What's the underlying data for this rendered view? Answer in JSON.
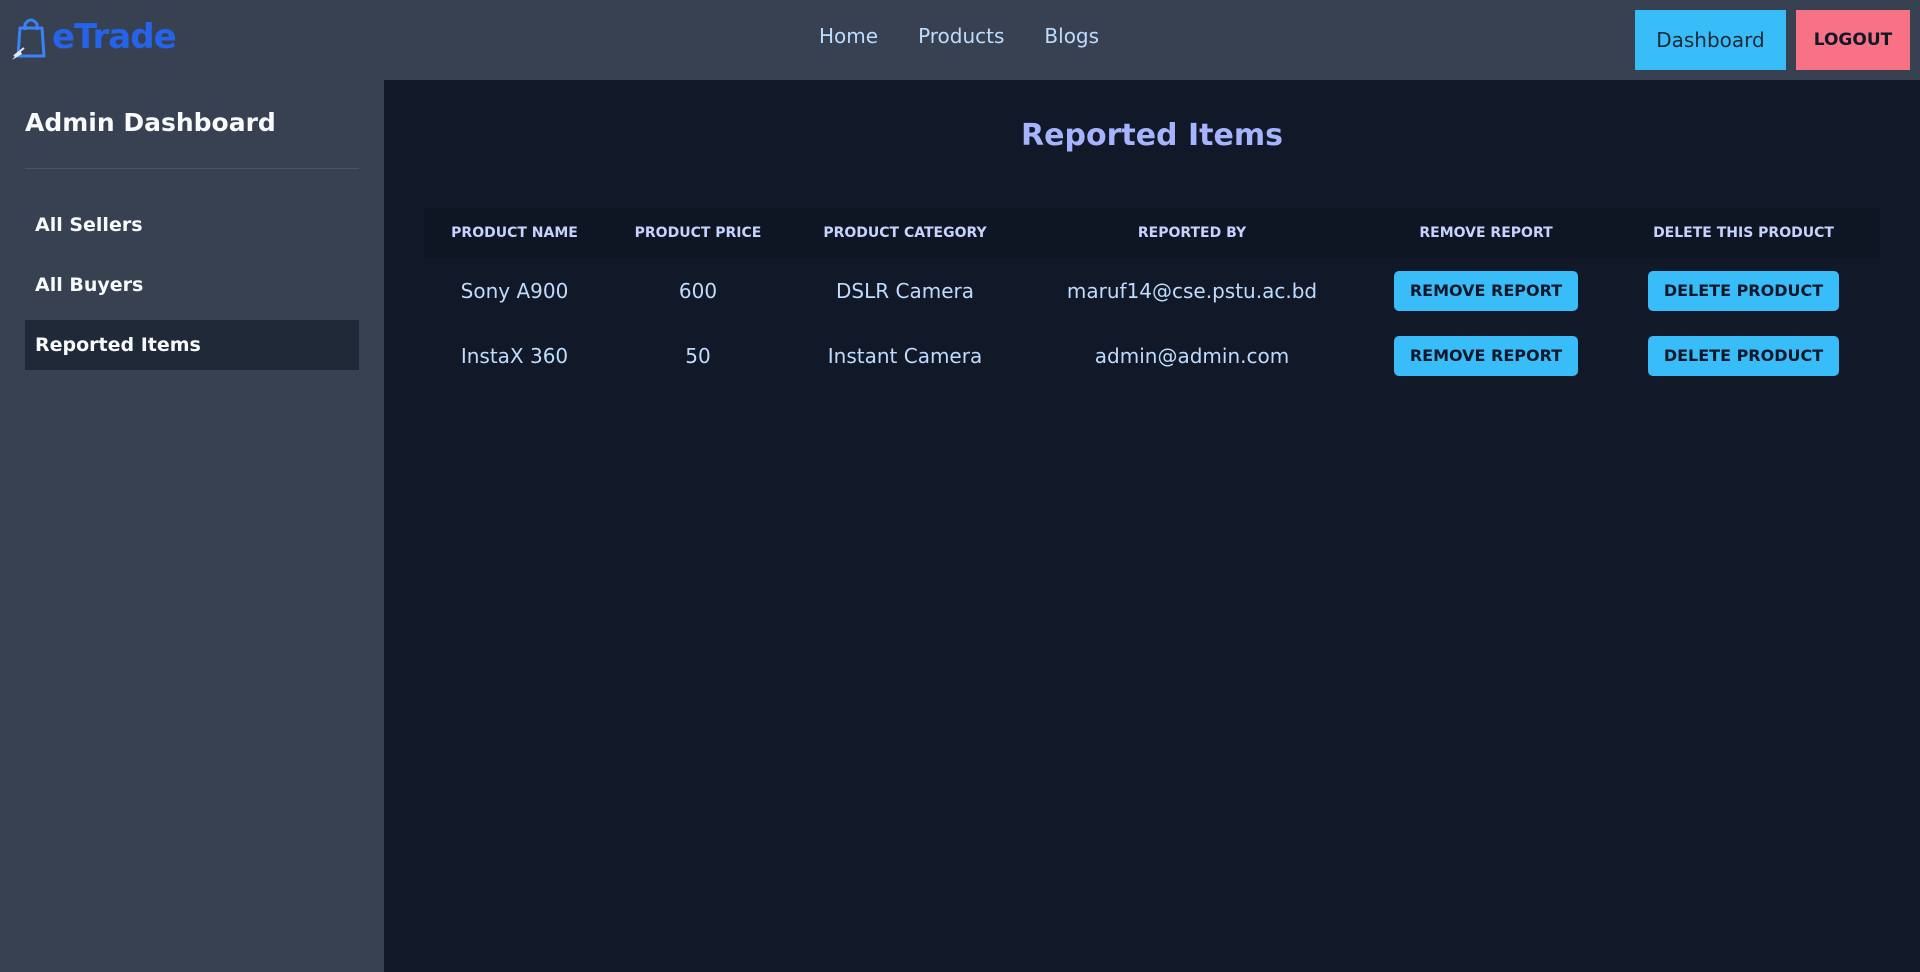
{
  "brand": {
    "name": "eTrade",
    "icon": "shopping-bag-icon"
  },
  "nav": {
    "links": [
      {
        "label": "Home"
      },
      {
        "label": "Products"
      },
      {
        "label": "Blogs"
      }
    ],
    "dashboard_label": "Dashboard",
    "logout_label": "LOGOUT"
  },
  "sidebar": {
    "title": "Admin Dashboard",
    "items": [
      {
        "label": "All Sellers",
        "active": false
      },
      {
        "label": "All Buyers",
        "active": false
      },
      {
        "label": "Reported Items",
        "active": true
      }
    ]
  },
  "main": {
    "title": "Reported Items",
    "table": {
      "headers": [
        "PRODUCT NAME",
        "PRODUCT PRICE",
        "PRODUCT CATEGORY",
        "REPORTED BY",
        "REMOVE REPORT",
        "DELETE THIS PRODUCT"
      ],
      "rows": [
        {
          "name": "Sony A900",
          "price": "600",
          "category": "DSLR Camera",
          "reported_by": "maruf14@cse.pstu.ac.bd",
          "remove_label": "REMOVE REPORT",
          "delete_label": "DELETE PRODUCT"
        },
        {
          "name": "InstaX 360",
          "price": "50",
          "category": "Instant Camera",
          "reported_by": "admin@admin.com",
          "remove_label": "REMOVE REPORT",
          "delete_label": "DELETE PRODUCT"
        }
      ]
    }
  },
  "colors": {
    "navbar_bg": "#374151",
    "main_bg": "#111827",
    "accent_button": "#38bdf8",
    "logout_button": "#f87185",
    "brand_blue": "#2563eb"
  }
}
